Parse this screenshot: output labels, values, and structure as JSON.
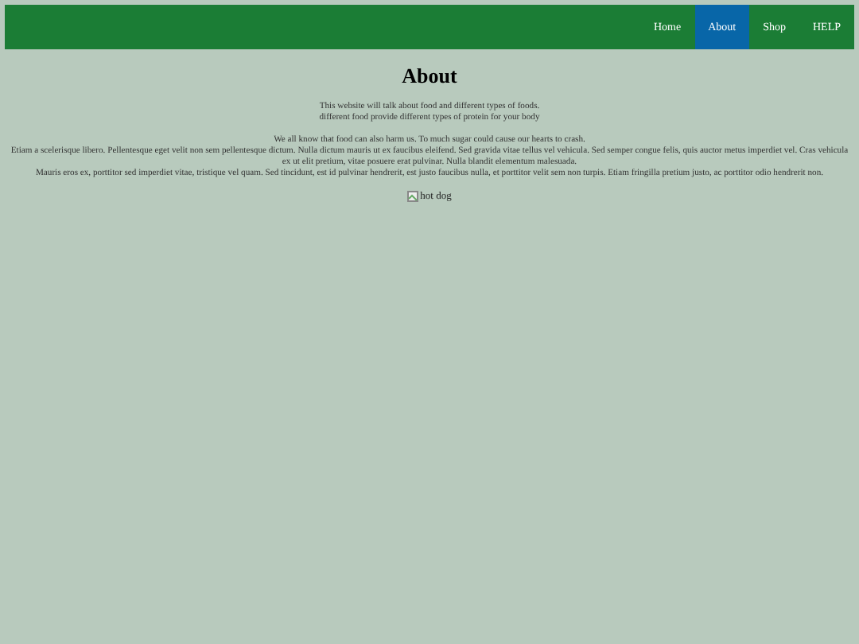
{
  "nav": {
    "items": [
      {
        "label": "Home",
        "selected": false
      },
      {
        "label": "About",
        "selected": true
      },
      {
        "label": "Shop",
        "selected": false
      },
      {
        "label": "HELP",
        "selected": false
      }
    ]
  },
  "heading": "About",
  "paragraphs": [
    [
      "This website will talk about food and different types of foods.",
      "different food provide different types of protein for your body"
    ],
    [
      "We all know that food can also harm us. To much sugar could cause our hearts to crash.",
      "Etiam a scelerisque libero. Pellentesque eget velit non sem pellentesque dictum. Nulla dictum mauris ut ex faucibus eleifend. Sed gravida vitae tellus vel vehicula. Sed semper congue felis, quis auctor metus imperdiet vel. Cras vehicula ex ut elit pretium, vitae posuere erat pulvinar. Nulla blandit elementum malesuada.",
      "Mauris eros ex, porttitor sed imperdiet vitae, tristique vel quam. Sed tincidunt, est id pulvinar hendrerit, est justo faucibus nulla, et porttitor velit sem non turpis. Etiam fringilla pretium justo, ac porttitor odio hendrerit non."
    ]
  ],
  "image": {
    "alt": "hot dog"
  }
}
